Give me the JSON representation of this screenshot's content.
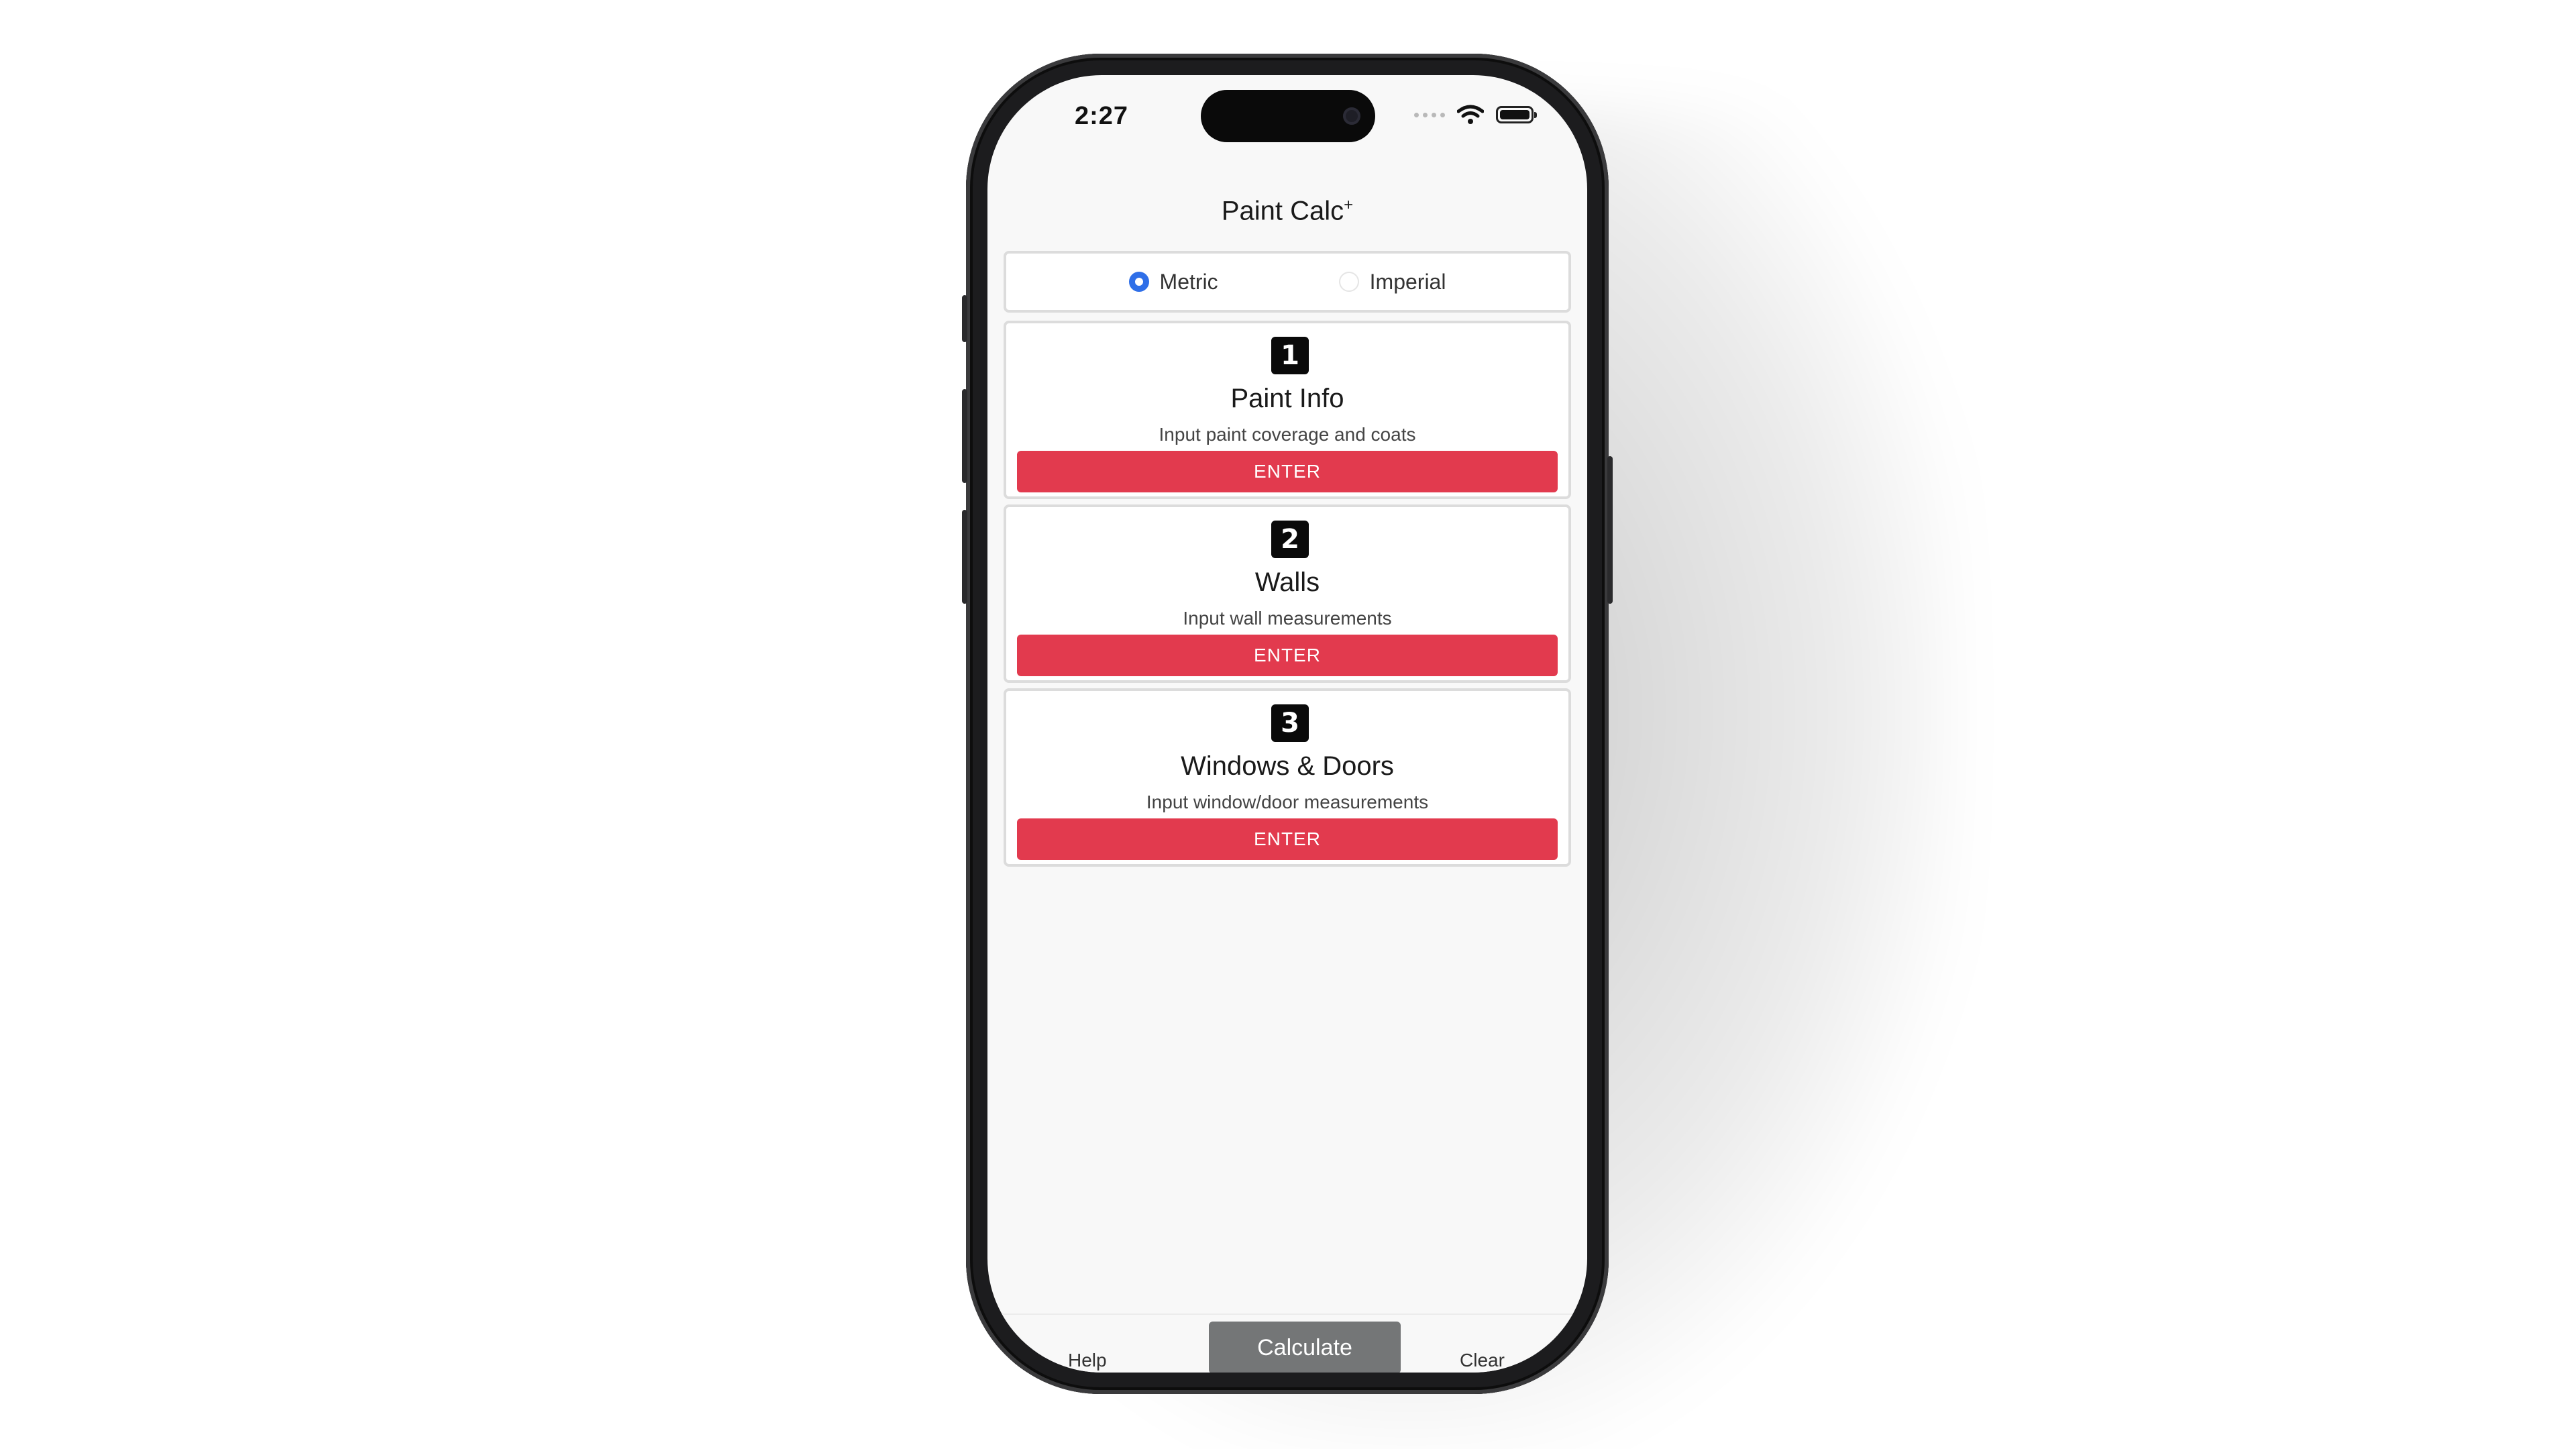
{
  "status_bar": {
    "time": "2:27"
  },
  "app": {
    "title": "Paint Calc",
    "title_superscript": "+"
  },
  "units": {
    "options": [
      {
        "label": "Metric",
        "selected": true
      },
      {
        "label": "Imperial",
        "selected": false
      }
    ]
  },
  "cards": [
    {
      "step": "1",
      "title": "Paint Info",
      "subtitle": "Input paint coverage and coats",
      "button_label": "ENTER"
    },
    {
      "step": "2",
      "title": "Walls",
      "subtitle": "Input wall measurements",
      "button_label": "ENTER"
    },
    {
      "step": "3",
      "title": "Windows & Doors",
      "subtitle": "Input window/door measurements",
      "button_label": "ENTER"
    }
  ],
  "bottom_bar": {
    "help_label": "Help",
    "calculate_label": "Calculate",
    "clear_label": "Clear"
  },
  "colors": {
    "accent_red": "#e23a4e",
    "radio_blue": "#2f6fe8",
    "calculate_gray": "#747677"
  },
  "icons": {
    "status": [
      "cellular-signal-icon",
      "wifi-icon",
      "battery-icon"
    ],
    "step_badges": [
      "number-one-icon",
      "number-two-icon",
      "number-three-icon"
    ]
  }
}
